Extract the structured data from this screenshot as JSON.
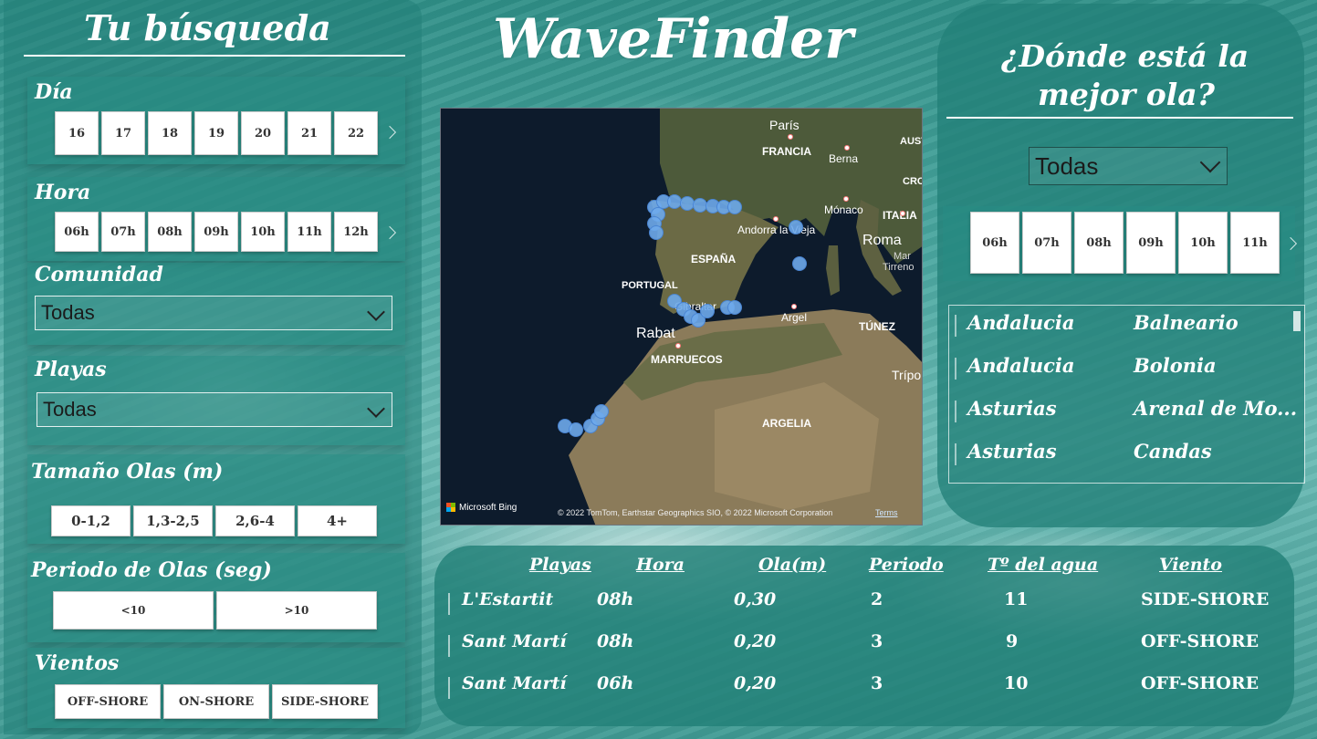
{
  "app": {
    "title": "WaveFinder"
  },
  "search": {
    "title": "Tu búsqueda",
    "day": {
      "label": "Día",
      "options": [
        "16",
        "17",
        "18",
        "19",
        "20",
        "21",
        "22"
      ]
    },
    "hour": {
      "label": "Hora",
      "options": [
        "06h",
        "07h",
        "08h",
        "09h",
        "10h",
        "11h",
        "12h"
      ]
    },
    "community": {
      "label": "Comunidad",
      "value": "Todas"
    },
    "beaches": {
      "label": "Playas",
      "value": "Todas"
    },
    "wave_size": {
      "label": "Tamaño Olas (m)",
      "options": [
        "0-1,2",
        "1,3-2,5",
        "2,6-4",
        "4+"
      ]
    },
    "wave_period": {
      "label": "Periodo de Olas (seg)",
      "options": [
        "<10",
        ">10"
      ]
    },
    "winds": {
      "label": "Vientos",
      "options": [
        "OFF-SHORE",
        "ON-SHORE",
        "SIDE-SHORE"
      ]
    }
  },
  "best_wave": {
    "title_line1": "¿Dónde está la",
    "title_line2": "mejor ola?",
    "dropdown_value": "Todas",
    "hours": [
      "06h",
      "07h",
      "08h",
      "09h",
      "10h",
      "11h"
    ],
    "list": [
      {
        "region": "Andalucia",
        "beach": "Balneario"
      },
      {
        "region": "Andalucia",
        "beach": "Bolonia"
      },
      {
        "region": "Asturias",
        "beach": "Arenal de Mo..."
      },
      {
        "region": "Asturias",
        "beach": "Candas"
      }
    ]
  },
  "map": {
    "labels": {
      "paris": "París",
      "francia": "FRANCIA",
      "berna": "Berna",
      "aust": "AUST",
      "cro": "CRO",
      "monaco": "Mónaco",
      "italia": "ITALIA",
      "roma": "Roma",
      "mar_tirreno_1": "Mar",
      "mar_tirreno_2": "Tirreno",
      "andorra": "Andorra la Vieja",
      "espana": "ESPAÑA",
      "portugal": "PORTUGAL",
      "gibraltar": "Gibraltar",
      "rabat": "Rabat",
      "argel": "Argel",
      "tunez": "TÚNEZ",
      "marruecos": "MARRUECOS",
      "argelia": "ARGELIA",
      "tripoli": "Trípo"
    },
    "attribution": "© 2022 TomTom, Earthstar Geographics SIO, © 2022 Microsoft Corporation",
    "terms": "Terms",
    "brand": "Microsoft Bing"
  },
  "table": {
    "headers": [
      "Playas",
      "Hora",
      "Ola(m)",
      "Periodo",
      "Tº del agua",
      "Viento"
    ],
    "rows": [
      {
        "playa": "L'Estartit",
        "hora": "08h",
        "ola": "0,30",
        "periodo": "2",
        "agua": "11",
        "viento": "SIDE-SHORE"
      },
      {
        "playa": "Sant Martí",
        "hora": "08h",
        "ola": "0,20",
        "periodo": "3",
        "agua": "9",
        "viento": "OFF-SHORE"
      },
      {
        "playa": "Sant Martí",
        "hora": "06h",
        "ola": "0,20",
        "periodo": "3",
        "agua": "10",
        "viento": "OFF-SHORE"
      }
    ]
  }
}
